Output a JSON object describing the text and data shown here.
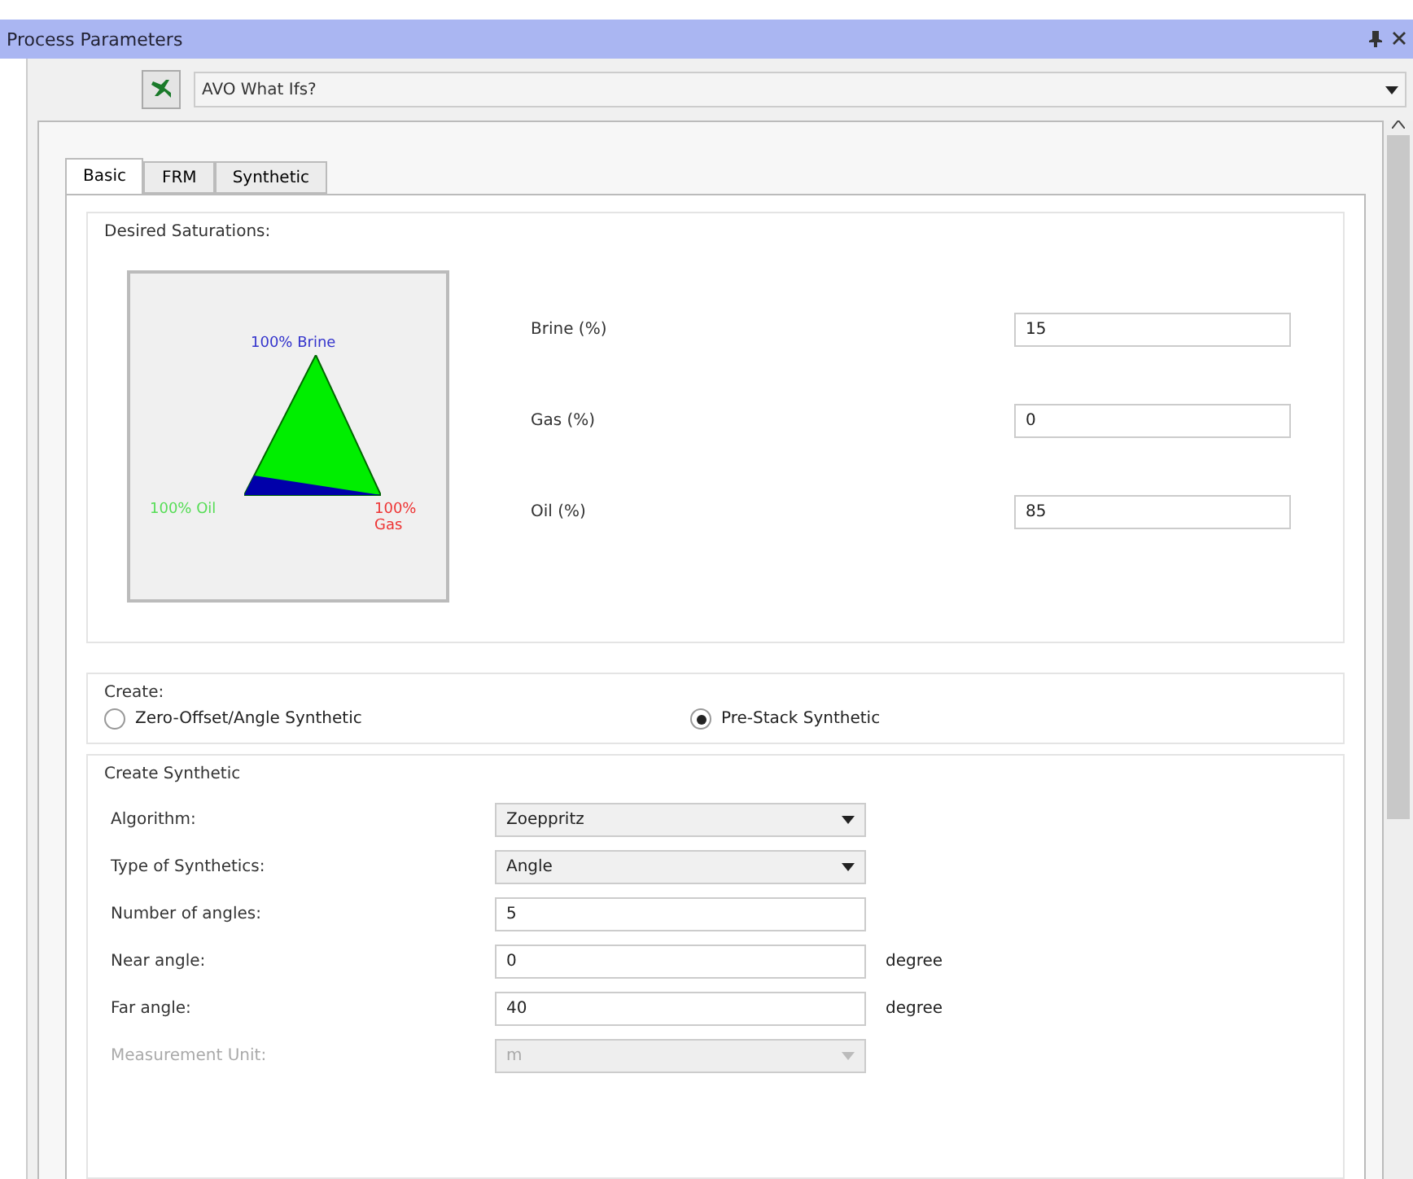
{
  "window": {
    "title": "Process Parameters"
  },
  "process": {
    "value": "AVO What Ifs?"
  },
  "tabs": [
    {
      "label": "Basic",
      "selected": true
    },
    {
      "label": "FRM",
      "selected": false
    },
    {
      "label": "Synthetic",
      "selected": false
    }
  ],
  "saturations": {
    "title": "Desired Saturations:",
    "labels": {
      "brine": "100% Brine",
      "oil": "100% Oil",
      "gas": "100% Gas"
    },
    "fields": [
      {
        "label": "Brine (%)",
        "value": "15"
      },
      {
        "label": "Gas (%)",
        "value": "0"
      },
      {
        "label": "Oil (%)",
        "value": "85"
      }
    ]
  },
  "create": {
    "title": "Create:",
    "options": [
      {
        "label": "Zero-Offset/Angle Synthetic",
        "selected": false
      },
      {
        "label": "Pre-Stack Synthetic",
        "selected": true
      }
    ]
  },
  "create_synthetic": {
    "title": "Create Synthetic",
    "rows": [
      {
        "kind": "combo",
        "label": "Algorithm:",
        "value": "Zoeppritz",
        "disabled": false
      },
      {
        "kind": "combo",
        "label": "Type of Synthetics:",
        "value": "Angle",
        "disabled": false
      },
      {
        "kind": "input",
        "label": "Number of angles:",
        "value": "5",
        "disabled": false
      },
      {
        "kind": "input",
        "label": "Near angle:",
        "value": "0",
        "unit": "degree",
        "disabled": false
      },
      {
        "kind": "input",
        "label": "Far angle:",
        "value": "40",
        "unit": "degree",
        "disabled": false
      },
      {
        "kind": "combo",
        "label": "Measurement Unit:",
        "value": "m",
        "disabled": true
      }
    ]
  }
}
